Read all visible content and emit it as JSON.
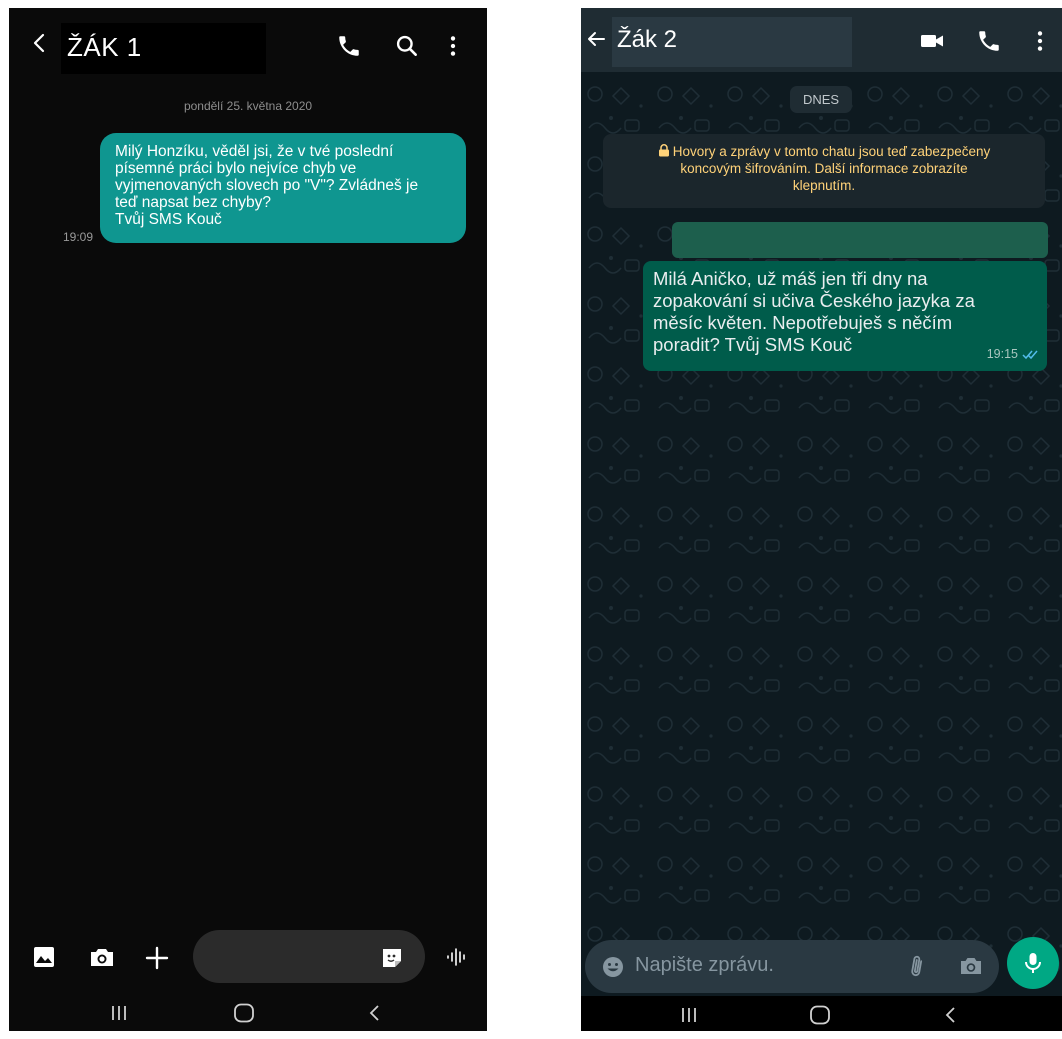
{
  "left_phone": {
    "contact_name": "ŽÁK 1",
    "date_separator": "pondělí 25. května 2020",
    "message": {
      "lines": [
        "Milý Honzíku, věděl jsi, že v tvé poslední",
        "písemné práci bylo nejvíce chyb ve",
        "vyjmenovaných slovech po \"V\"? Zvládneš je",
        "teď napsat bez chyby?",
        "Tvůj SMS Kouč"
      ],
      "time": "19:09"
    },
    "icons": {
      "back": "chevron-left-icon",
      "call": "phone-icon",
      "search": "search-icon",
      "menu": "more-vertical-icon",
      "gallery": "image-icon",
      "camera": "camera-icon",
      "add": "plus-icon",
      "sticker": "sticker-icon",
      "voice": "voice-wave-icon"
    },
    "colors": {
      "background": "#0a0a0a",
      "bubble": "#0f9690",
      "input": "#2b2b2b"
    }
  },
  "right_phone": {
    "contact_name": "Žák 2",
    "date_pill": "DNES",
    "encryption_notice": [
      "Hovory a zprávy v tomto chatu jsou teď zabezpečeny",
      "koncovým šifrováním. Další informace zobrazíte",
      "klepnutím."
    ],
    "message": {
      "lines": [
        "Milá Aničko, už máš jen tři dny na",
        "zopakování si učiva Českého jazyka za",
        "měsíc květen. Nepotřebuješ s něčím",
        "poradit? Tvůj SMS Kouč"
      ],
      "time": "19:15"
    },
    "input_placeholder": "Napište zprávu.",
    "icons": {
      "back": "arrow-left-icon",
      "video": "video-call-icon",
      "call": "phone-icon",
      "menu": "more-vertical-icon",
      "emoji": "emoji-icon",
      "attach": "paperclip-icon",
      "camera": "camera-icon",
      "mic": "microphone-icon",
      "read": "double-check-icon",
      "lock": "lock-icon"
    },
    "colors": {
      "header": "#1f2c33",
      "bubble": "#005c4b",
      "notice_text": "#ffd279",
      "mic_button": "#00a884",
      "read_ticks": "#53bdeb"
    }
  },
  "system_nav": {
    "icons": [
      "recent-apps-icon",
      "home-icon",
      "back-icon"
    ]
  }
}
